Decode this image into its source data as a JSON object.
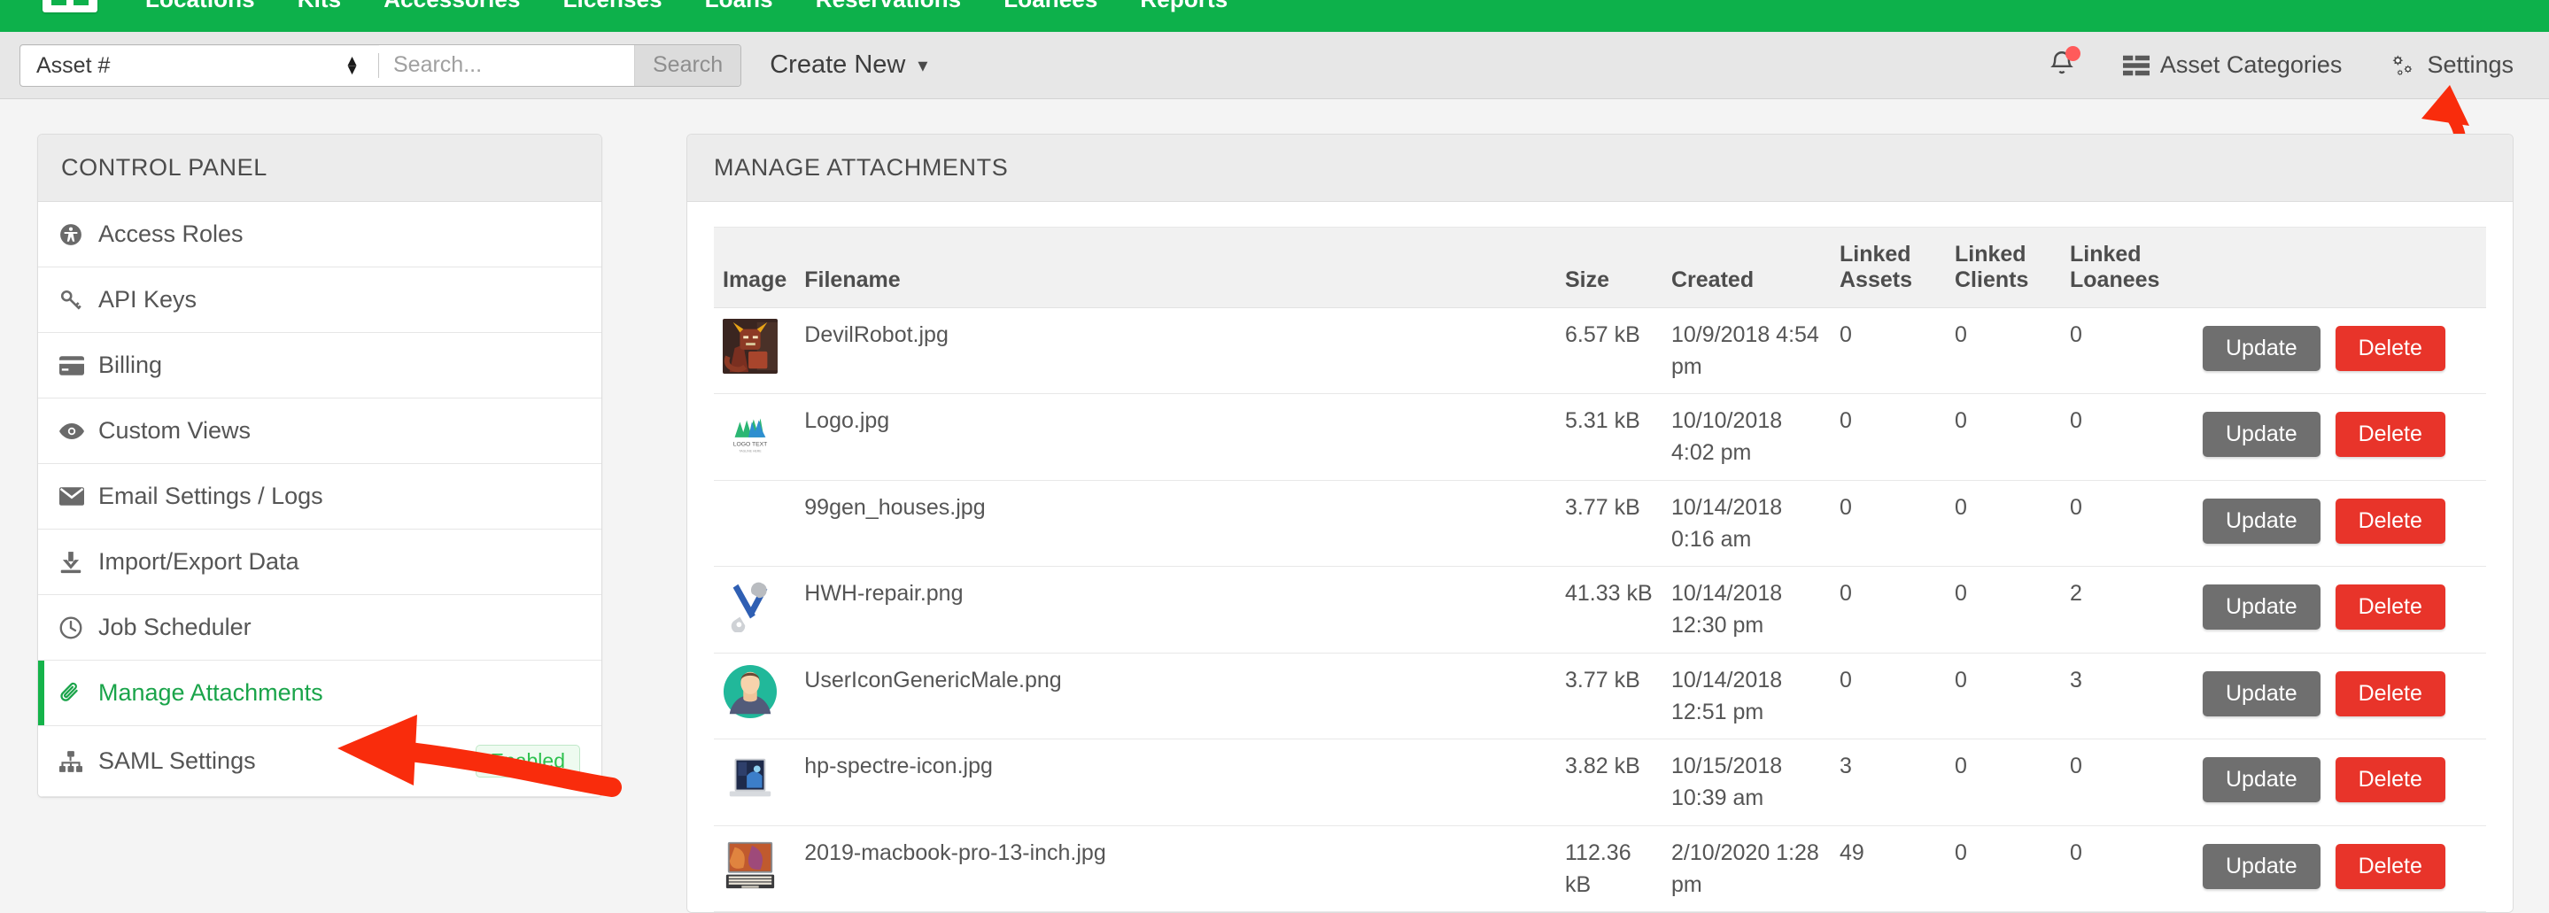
{
  "topnav": {
    "logo": "brand-logo",
    "items": [
      {
        "label": "Locations"
      },
      {
        "label": "Kits"
      },
      {
        "label": "Accessories"
      },
      {
        "label": "Licenses"
      },
      {
        "label": "Loans"
      },
      {
        "label": "Reservations"
      },
      {
        "label": "Loanees"
      },
      {
        "label": "Reports"
      }
    ],
    "accent_green": "#0db14b"
  },
  "subbar": {
    "type_select_value": "Asset #",
    "search_placeholder": "Search...",
    "search_value": "",
    "search_button_label": "Search",
    "create_new_label": "Create New",
    "create_new_caret": "∨",
    "notifications_has_alert": true,
    "asset_categories_label": "Asset Categories",
    "settings_label": "Settings"
  },
  "sidebar": {
    "title": "CONTROL PANEL",
    "items": [
      {
        "label": "Access Roles",
        "icon": "universal-access-icon",
        "active": false,
        "badge": ""
      },
      {
        "label": "API Keys",
        "icon": "key-icon",
        "active": false,
        "badge": ""
      },
      {
        "label": "Billing",
        "icon": "credit-card-icon",
        "active": false,
        "badge": ""
      },
      {
        "label": "Custom Views",
        "icon": "eye-icon",
        "active": false,
        "badge": ""
      },
      {
        "label": "Email Settings / Logs",
        "icon": "envelope-icon",
        "active": false,
        "badge": ""
      },
      {
        "label": "Import/Export Data",
        "icon": "download-icon",
        "active": false,
        "badge": ""
      },
      {
        "label": "Job Scheduler",
        "icon": "clock-icon",
        "active": false,
        "badge": ""
      },
      {
        "label": "Manage Attachments",
        "icon": "paperclip-icon",
        "active": true,
        "badge": ""
      },
      {
        "label": "SAML Settings",
        "icon": "sitemap-icon",
        "active": false,
        "badge": "Enabled"
      }
    ]
  },
  "main": {
    "title": "MANAGE ATTACHMENTS",
    "columns": [
      "Image",
      "Filename",
      "Size",
      "Created",
      "Linked Assets",
      "Linked Clients",
      "Linked Loanees",
      ""
    ],
    "update_label": "Update",
    "delete_label": "Delete",
    "rows": [
      {
        "thumb": "devil-robot-thumbnail",
        "filename": "DevilRobot.jpg",
        "size": "6.57 kB",
        "created": "10/9/2018 4:54 pm",
        "linked_assets": "0",
        "linked_clients": "0",
        "linked_loanees": "0"
      },
      {
        "thumb": "logo-thumbnail",
        "filename": "Logo.jpg",
        "size": "5.31 kB",
        "created": "10/10/2018 4:02 pm",
        "linked_assets": "0",
        "linked_clients": "0",
        "linked_loanees": "0"
      },
      {
        "thumb": "no-thumbnail",
        "filename": "99gen_houses.jpg",
        "size": "3.77 kB",
        "created": "10/14/2018 0:16 am",
        "linked_assets": "0",
        "linked_clients": "0",
        "linked_loanees": "0"
      },
      {
        "thumb": "repair-tools-thumbnail",
        "filename": "HWH-repair.png",
        "size": "41.33 kB",
        "created": "10/14/2018 12:30 pm",
        "linked_assets": "0",
        "linked_clients": "0",
        "linked_loanees": "2"
      },
      {
        "thumb": "user-avatar-thumbnail",
        "filename": "UserIconGenericMale.png",
        "size": "3.77 kB",
        "created": "10/14/2018 12:51 pm",
        "linked_assets": "0",
        "linked_clients": "0",
        "linked_loanees": "3"
      },
      {
        "thumb": "hp-spectre-thumbnail",
        "filename": "hp-spectre-icon.jpg",
        "size": "3.82 kB",
        "created": "10/15/2018 10:39 am",
        "linked_assets": "3",
        "linked_clients": "0",
        "linked_loanees": "0"
      },
      {
        "thumb": "macbook-pro-thumbnail",
        "filename": "2019-macbook-pro-13-inch.jpg",
        "size": "112.36 kB",
        "created": "2/10/2020 1:28 pm",
        "linked_assets": "49",
        "linked_clients": "0",
        "linked_loanees": "0"
      }
    ]
  },
  "annotations": {
    "arrow_color": "#f92c0c",
    "arrow_settings_target": "Settings",
    "arrow_sidebar_target": "Manage Attachments"
  }
}
